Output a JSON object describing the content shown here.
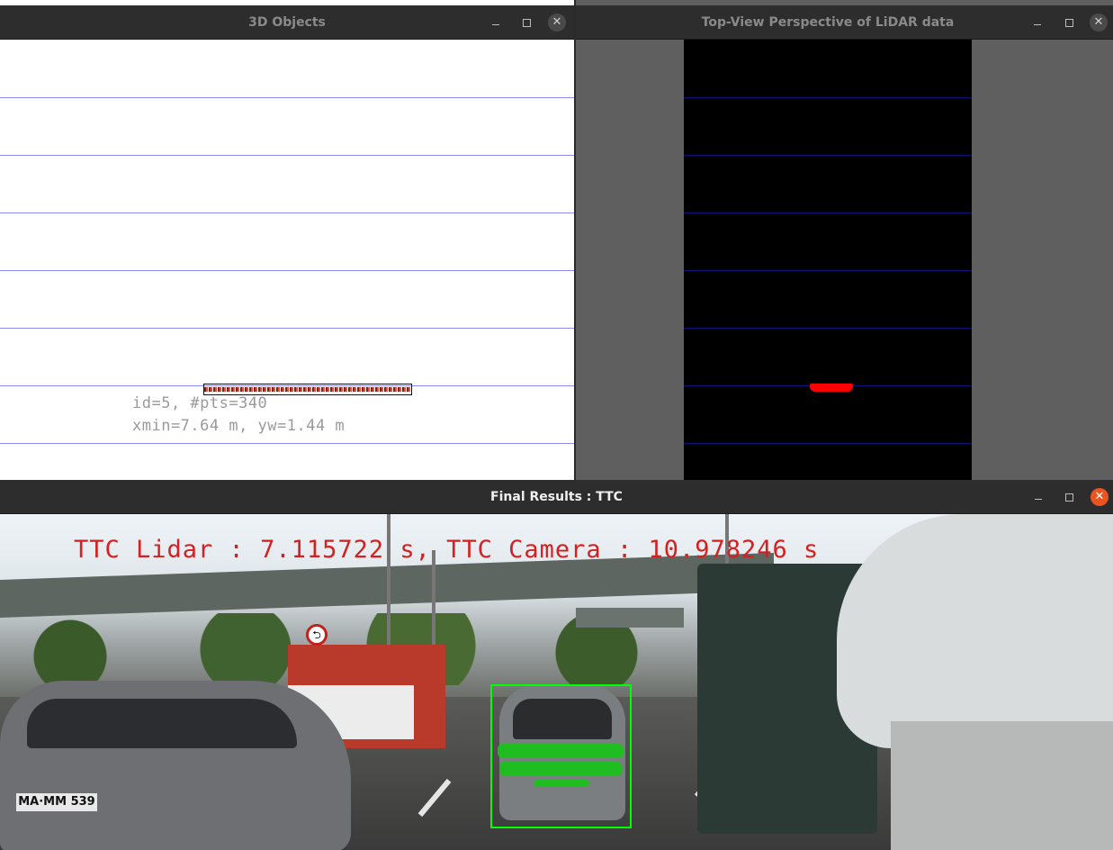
{
  "windows": {
    "objects3d": {
      "title": "3D Objects",
      "label_line1": "id=5, #pts=340",
      "label_line2": "xmin=7.64 m, yw=1.44 m"
    },
    "topview": {
      "title": "Top-View Perspective of LiDAR data"
    },
    "final": {
      "title": "Final Results : TTC",
      "overlay_text": "TTC Lidar : 7.115722 s, TTC Camera : 10.978246 s",
      "plate_text": "MA·MM 539"
    }
  },
  "controls": {
    "minimize": "–",
    "maximize": "□",
    "close": "✕"
  },
  "colors": {
    "gridline_3d": "#8c8cf0",
    "gridline_topview": "#10107a",
    "lidar_points": "#ff0000",
    "detection_box": "#00ff00",
    "ttc_text": "#d42020",
    "close_active": "#e95420"
  },
  "icons": [
    "minimize-icon",
    "maximize-icon",
    "close-icon",
    "no-u-turn-sign-icon"
  ]
}
